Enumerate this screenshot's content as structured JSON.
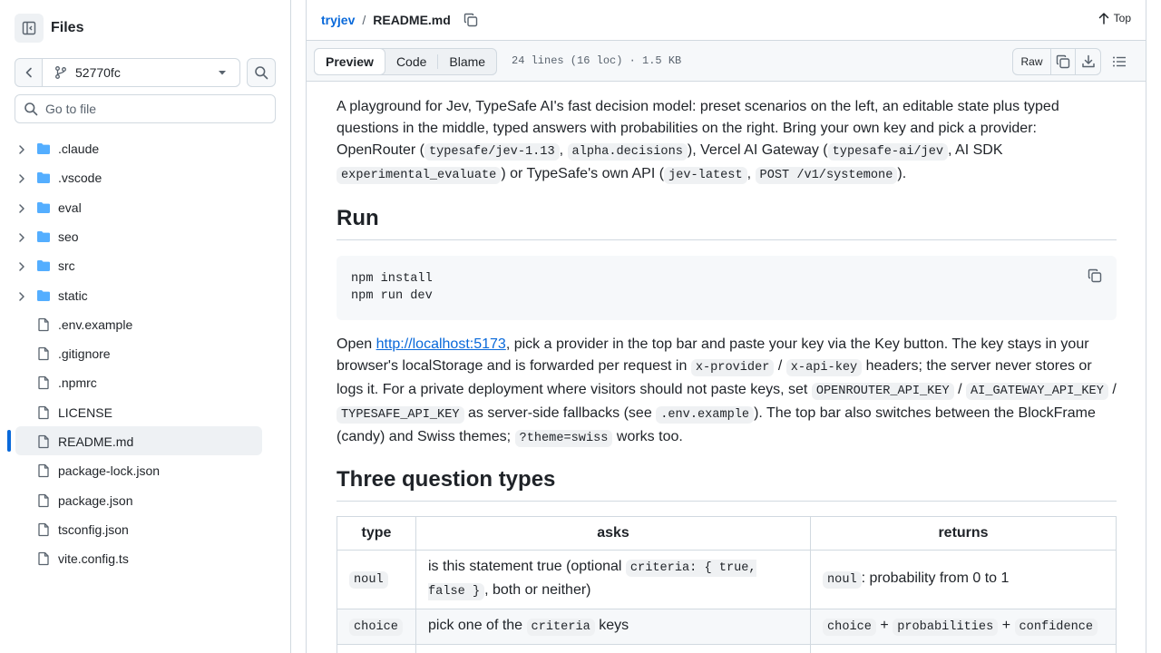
{
  "sidebar": {
    "title": "Files",
    "branch": "52770fc",
    "goto_placeholder": "Go to file",
    "tree": [
      {
        "label": ".claude",
        "type": "folder"
      },
      {
        "label": ".vscode",
        "type": "folder"
      },
      {
        "label": "eval",
        "type": "folder"
      },
      {
        "label": "seo",
        "type": "folder"
      },
      {
        "label": "src",
        "type": "folder"
      },
      {
        "label": "static",
        "type": "folder"
      },
      {
        "label": ".env.example",
        "type": "file"
      },
      {
        "label": ".gitignore",
        "type": "file"
      },
      {
        "label": ".npmrc",
        "type": "file"
      },
      {
        "label": "LICENSE",
        "type": "file"
      },
      {
        "label": "README.md",
        "type": "file",
        "selected": true
      },
      {
        "label": "package-lock.json",
        "type": "file"
      },
      {
        "label": "package.json",
        "type": "file"
      },
      {
        "label": "tsconfig.json",
        "type": "file"
      },
      {
        "label": "vite.config.ts",
        "type": "file"
      }
    ]
  },
  "header": {
    "repo": "tryjev",
    "separator": "/",
    "file": "README.md",
    "top_label": "Top"
  },
  "file_header": {
    "tabs": [
      "Preview",
      "Code",
      "Blame"
    ],
    "active_tab": "Preview",
    "meta": "24 lines (16 loc) · 1.5 KB",
    "raw_label": "Raw"
  },
  "readme": {
    "intro": {
      "t1": "A playground for Jev, TypeSafe AI's fast decision model: preset scenarios on the left, an editable state plus typed questions in the middle, typed answers with probabilities on the right. Bring your own key and pick a provider: OpenRouter (",
      "c1": "typesafe/jev-1.13",
      "t2": ",",
      "c2": "alpha.decisions",
      "t3": "), Vercel AI Gateway (",
      "c3": "typesafe-ai/jev",
      "t4": ", AI SDK",
      "c4": "experimental_evaluate",
      "t5": ") or TypeSafe's own API (",
      "c5": "jev-latest",
      "t6": ",",
      "c6": "POST /v1/systemone",
      "t7": ")."
    },
    "run_heading": "Run",
    "code_lines": [
      "npm install",
      "npm run dev"
    ],
    "open": {
      "t1": "Open",
      "link": "http://localhost:5173",
      "t2": ", pick a provider in the top bar and paste your key via the Key button. The key stays in your browser's localStorage and is forwarded per request in",
      "c1": "x-provider",
      "t3": "/",
      "c2": "x-api-key",
      "t4": "headers; the server never stores or logs it. For a private deployment where visitors should not paste keys, set",
      "c3": "OPENROUTER_API_KEY",
      "t5": "/",
      "c4": "AI_GATEWAY_API_KEY",
      "t6": "/",
      "c5": "TYPESAFE_API_KEY",
      "t7": "as server-side fallbacks (see",
      "c6": ".env.example",
      "t8": "). The top bar also switches between the BlockFrame (candy) and Swiss themes;",
      "c7": "?theme=swiss",
      "t9": "works too."
    },
    "types_heading": "Three question types",
    "table": {
      "headers": [
        "type",
        "asks",
        "returns"
      ],
      "row1": {
        "type": "noul",
        "asks_t1": "is this statement true (optional",
        "asks_c1": "criteria: { true, false }",
        "asks_t2": ", both or neither)",
        "ret_c1": "noul",
        "ret_t1": ": probability from 0 to 1"
      },
      "row2": {
        "type": "choice",
        "asks_t1": "pick one of the",
        "asks_c1": "criteria",
        "asks_t2": "keys",
        "ret_c1": "choice",
        "ret_plus1": "+",
        "ret_c2": "probabilities",
        "ret_plus2": "+",
        "ret_c3": "confidence"
      }
    }
  }
}
